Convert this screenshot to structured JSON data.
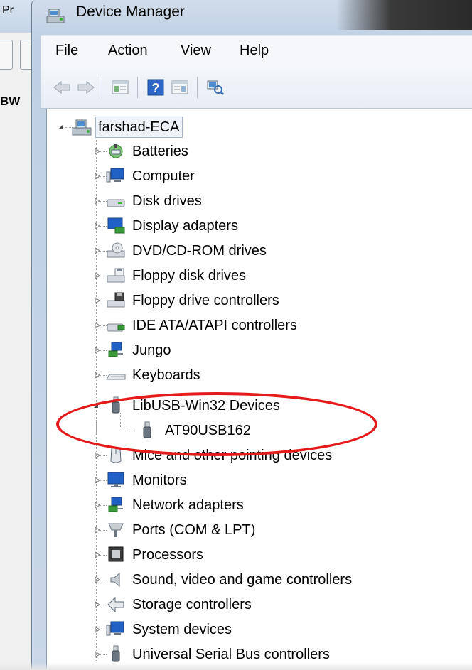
{
  "background_app": {
    "title_fragment": "Pr",
    "side_label": "BW"
  },
  "window": {
    "title": "Device Manager"
  },
  "menu": {
    "items": [
      "File",
      "Action",
      "View",
      "Help"
    ]
  },
  "toolbar": {
    "buttons": [
      "back-arrow-icon",
      "forward-arrow-icon",
      "properties-icon",
      "help-icon",
      "show-hidden-icon",
      "scan-hardware-icon"
    ]
  },
  "tree": {
    "root": "farshad-ECA",
    "categories": [
      {
        "label": "Batteries",
        "icon": "battery-icon"
      },
      {
        "label": "Computer",
        "icon": "computer-icon"
      },
      {
        "label": "Disk drives",
        "icon": "disk-drive-icon"
      },
      {
        "label": "Display adapters",
        "icon": "display-adapter-icon"
      },
      {
        "label": "DVD/CD-ROM drives",
        "icon": "dvd-drive-icon"
      },
      {
        "label": "Floppy disk drives",
        "icon": "floppy-drive-icon"
      },
      {
        "label": "Floppy drive controllers",
        "icon": "floppy-controller-icon"
      },
      {
        "label": "IDE ATA/ATAPI controllers",
        "icon": "ide-controller-icon"
      },
      {
        "label": "Jungo",
        "icon": "jungo-icon"
      },
      {
        "label": "Keyboards",
        "icon": "keyboard-icon"
      },
      {
        "label": "LibUSB-Win32 Devices",
        "icon": "usb-plug-icon",
        "expanded": true,
        "children": [
          {
            "label": "AT90USB162",
            "icon": "usb-plug-icon"
          }
        ]
      },
      {
        "label": "Mice and other pointing devices",
        "icon": "mouse-icon"
      },
      {
        "label": "Monitors",
        "icon": "monitor-icon"
      },
      {
        "label": "Network adapters",
        "icon": "network-adapter-icon"
      },
      {
        "label": "Ports (COM & LPT)",
        "icon": "port-icon"
      },
      {
        "label": "Processors",
        "icon": "processor-icon"
      },
      {
        "label": "Sound, video and game controllers",
        "icon": "sound-icon"
      },
      {
        "label": "Storage controllers",
        "icon": "storage-controller-icon"
      },
      {
        "label": "System devices",
        "icon": "system-devices-icon"
      },
      {
        "label": "Universal Serial Bus controllers",
        "icon": "usb-controller-icon"
      }
    ]
  },
  "annotation": {
    "color": "#e51b1b",
    "shape": "ellipse",
    "target": "LibUSB-Win32 Devices"
  },
  "colors": {
    "window_frame": "#c5d5e8",
    "tree_bg": "#ffffff",
    "annotation": "#e51b1b"
  }
}
